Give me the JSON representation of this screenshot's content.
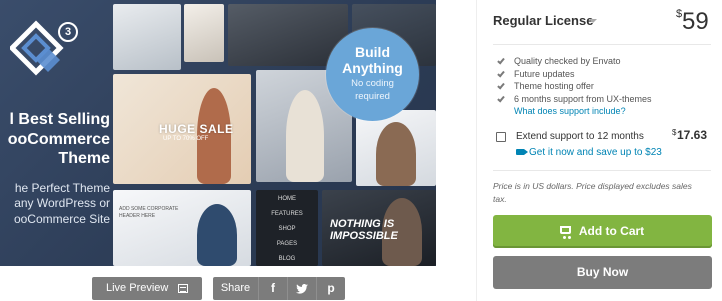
{
  "preview": {
    "logo_badge": "3",
    "promo_title_lines": [
      "l Best Selling",
      "ooCommerce",
      "Theme"
    ],
    "promo_sub_lines": [
      "he Perfect Theme",
      "any WordPress or",
      "ooCommerce Site"
    ],
    "build_badge": {
      "title_lines": [
        "Build",
        "Anything"
      ],
      "sub_lines": [
        "No coding",
        "required"
      ]
    },
    "huge_sale": "HUGE SALE",
    "huge_sale_sub": "UP TO 70% OFF",
    "card_headline": "ADD SOME CORPORATE HEADER HERE",
    "impossible_lines": [
      "NOTHING IS",
      "IMPOSSIBLE"
    ],
    "nav_items": [
      "HOME",
      "FEATURES",
      "SHOP",
      "PAGES",
      "BLOG"
    ]
  },
  "actions": {
    "live_preview": "Live Preview",
    "live_preview_icon": "preview-screen-icon",
    "share_label": "Share",
    "facebook_glyph": "f",
    "twitter_glyph": "t",
    "pinterest_glyph": "p"
  },
  "panel": {
    "license_title": "Regular License",
    "currency_symbol": "$",
    "price": "59",
    "features": [
      "Quality checked by Envato",
      "Future updates",
      "Theme hosting offer",
      "6 months support from UX-themes"
    ],
    "support_link": "What does support include?",
    "extend_label": "Extend support to 12 months",
    "extend_currency": "$",
    "extend_price": "17.63",
    "extend_promo": "Get it now and save up to $23",
    "price_note": "Price is in US dollars. Price displayed excludes sales tax.",
    "add_to_cart": "Add to Cart",
    "buy_now": "Buy Now"
  },
  "colors": {
    "accent_green": "#82b541",
    "link_blue": "#0084b4",
    "button_grey": "#7c7c7c",
    "badge_blue": "#6aa6d8"
  }
}
